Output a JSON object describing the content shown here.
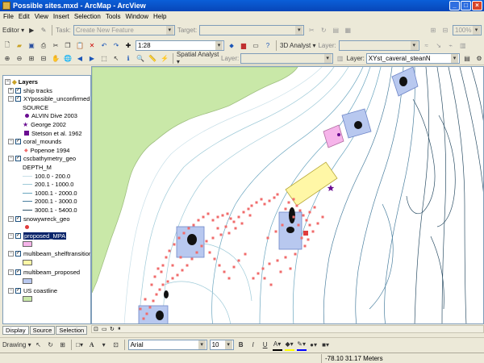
{
  "window": {
    "title": "Possible sites.mxd - ArcMap - ArcView",
    "minimize": "_",
    "maximize": "□",
    "close": "×"
  },
  "menu": [
    "File",
    "Edit",
    "View",
    "Insert",
    "Selection",
    "Tools",
    "Window",
    "Help"
  ],
  "toolbar_editor": {
    "editor_label": "Editor ▾",
    "task_label": "Task:",
    "task_value": "Create New Feature",
    "target_label": "Target:",
    "target_value": "",
    "zoom_pct": "100%"
  },
  "toolbar_standard": {
    "scale_value": "1:28",
    "analyst_3d": "3D Analyst ▾",
    "layer_label": "Layer:",
    "layer_value": ""
  },
  "toolbar_tools": {
    "spatial_analyst": "Spatial Analyst ▾",
    "layer_label": "Layer:",
    "layer_value": "",
    "layer2_label": "Layer:",
    "layer2_value": "XYst_caveral_steanN"
  },
  "toc": {
    "root": "Layers",
    "rows": [
      {
        "label": "ship tracks",
        "kind": "layer",
        "symbol": "none"
      },
      {
        "label": "XYpossible_unconfirmed",
        "kind": "layer",
        "symbol": "none"
      },
      {
        "label": "SOURCE",
        "kind": "heading"
      },
      {
        "label": "ALVIN Dive 2003",
        "kind": "item",
        "symbol": "dot",
        "color": "#6a0d91"
      },
      {
        "label": "George 2002",
        "kind": "item",
        "symbol": "star",
        "color": "#6a0d91"
      },
      {
        "label": "Stetson et al. 1962",
        "kind": "item",
        "symbol": "square",
        "color": "#6a0d91"
      },
      {
        "label": "coral_mounds",
        "kind": "layer",
        "symbol": "none"
      },
      {
        "label": "Popenoe 1994",
        "kind": "item",
        "symbol": "diamond",
        "color": "#f06b6b"
      },
      {
        "label": "cscbathymetry_geo",
        "kind": "layer",
        "symbol": "none"
      },
      {
        "label": "DEPTH_M",
        "kind": "heading"
      },
      {
        "label": "100.0 - 200.0",
        "kind": "item",
        "symbol": "line",
        "color": "#c8dfe8"
      },
      {
        "label": "200.1 - 1000.0",
        "kind": "item",
        "symbol": "line",
        "color": "#9ecad8"
      },
      {
        "label": "1000.1 - 2000.0",
        "kind": "item",
        "symbol": "line",
        "color": "#6aa5bf"
      },
      {
        "label": "2000.1 - 3000.0",
        "kind": "item",
        "symbol": "line",
        "color": "#4a7f9f"
      },
      {
        "label": "3000.1 - 5400.0",
        "kind": "item",
        "symbol": "line",
        "color": "#2c4f66"
      },
      {
        "label": "snowywreck_geo",
        "kind": "layer",
        "symbol": "none"
      },
      {
        "label": "",
        "kind": "item",
        "symbol": "dot",
        "color": "#e03c3c"
      },
      {
        "label": "proposed_MPA",
        "kind": "layer",
        "symbol": "none",
        "selected": true
      },
      {
        "label": "",
        "kind": "item",
        "symbol": "fill",
        "color": "#f6b4ea"
      },
      {
        "label": "multibeam_shelftransition",
        "kind": "layer",
        "symbol": "none"
      },
      {
        "label": "",
        "kind": "item",
        "symbol": "fill",
        "color": "#fff7a6"
      },
      {
        "label": "multibeam_proposed",
        "kind": "layer",
        "symbol": "none"
      },
      {
        "label": "",
        "kind": "item",
        "symbol": "fill",
        "color": "#b8c8ef"
      },
      {
        "label": "US coastline",
        "kind": "layer",
        "symbol": "none"
      },
      {
        "label": "",
        "kind": "item",
        "symbol": "fill",
        "color": "#c9e8a8"
      }
    ]
  },
  "tabs": [
    "Display",
    "Source",
    "Selection"
  ],
  "drawing_toolbar": {
    "drawing_label": "Drawing ▾",
    "font_name": "Arial",
    "font_size": "10",
    "bold": "B",
    "italic": "I",
    "underline": "U",
    "text_tool": "A"
  },
  "status": {
    "coords": "-78.10  31.17 Meters"
  },
  "colors": {
    "land": "#c9e8a8",
    "bathy_line": "#6aa5bf",
    "multibeam_fill": "#b8c8ef",
    "shelf_fill": "#fff7a6",
    "mpa_fill": "#f6b4ea",
    "coral": "#f06b6b",
    "title_bar": "#0a5fd8"
  }
}
